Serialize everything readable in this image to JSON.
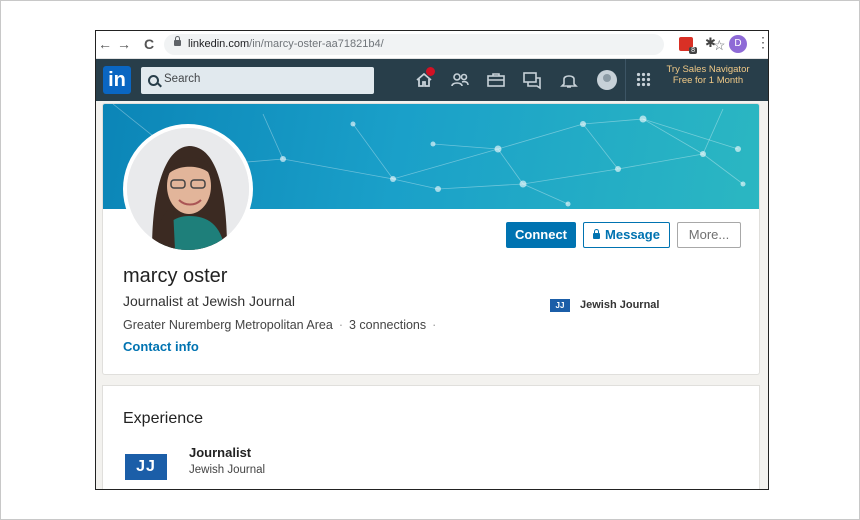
{
  "browser": {
    "url_host": "linkedin.com",
    "url_path": "/in/marcy-oster-aa71821b4/",
    "back_glyph": "←",
    "forward_glyph": "→",
    "reload_glyph": "C",
    "star_glyph": "☆",
    "ext_badge": "8",
    "puzzle_glyph": "✱",
    "profile_initial": "D",
    "menu_glyph": "⋮"
  },
  "header": {
    "logo_text": "in",
    "search_placeholder": "Search",
    "icons": [
      "home-icon",
      "my-network-icon",
      "jobs-icon",
      "messaging-icon",
      "notifications-icon",
      "me-avatar",
      "work-grid-icon"
    ],
    "sales_navigator_promo": "Try Sales Navigator Free for 1 Month",
    "accent_color": "#283e4a"
  },
  "profile": {
    "name": "marcy oster",
    "headline": "Journalist at Jewish Journal",
    "location": "Greater Nuremberg Metropolitan Area",
    "connections": "3 connections",
    "contact_info": "Contact info",
    "current_company_logo": "JJ",
    "current_company": "Jewish Journal",
    "buttons": {
      "connect": "Connect",
      "message": "Message",
      "more": "More..."
    },
    "primary_color": "#0073b1"
  },
  "experience": {
    "section_title": "Experience",
    "items": [
      {
        "logo_text": "JJ",
        "role": "Journalist",
        "company": "Jewish Journal"
      }
    ]
  }
}
